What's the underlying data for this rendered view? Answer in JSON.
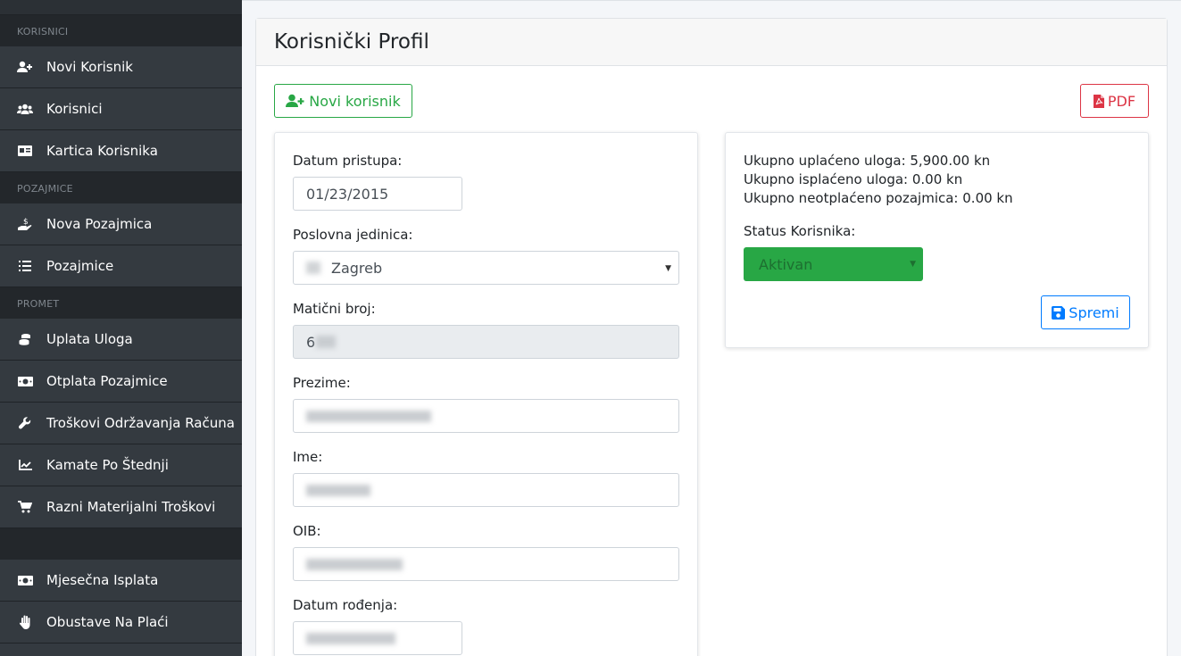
{
  "sidebar": {
    "sections": [
      {
        "title": "KORISNICI",
        "items": [
          {
            "label": "Novi Korisnik",
            "icon": "user-plus-icon"
          },
          {
            "label": "Korisnici",
            "icon": "users-icon"
          },
          {
            "label": "Kartica Korisnika",
            "icon": "id-card-icon"
          }
        ]
      },
      {
        "title": "POZAJMICE",
        "items": [
          {
            "label": "Nova Pozajmica",
            "icon": "hand-holding-dollar-icon"
          },
          {
            "label": "Pozajmice",
            "icon": "list-icon"
          }
        ]
      },
      {
        "title": "PROMET",
        "items": [
          {
            "label": "Uplata Uloga",
            "icon": "coins-icon"
          },
          {
            "label": "Otplata Pozajmice",
            "icon": "money-bill-icon"
          },
          {
            "label": "Troškovi Održavanja Računa",
            "icon": "wrench-icon"
          },
          {
            "label": "Kamate Po Štednji",
            "icon": "chart-line-icon"
          },
          {
            "label": "Razni Materijalni Troškovi",
            "icon": "shopping-cart-icon"
          }
        ]
      },
      {
        "title": "",
        "items": [
          {
            "label": "Mjesečna Isplata",
            "icon": "money-bill-icon"
          },
          {
            "label": "Obustave Na Plaći",
            "icon": "hand-paper-icon"
          }
        ]
      }
    ]
  },
  "page": {
    "title": "Korisnički Profil",
    "new_user_button": "Novi korisnik",
    "pdf_button": "PDF",
    "save_button": "Spremi"
  },
  "form": {
    "access_date_label": "Datum pristupa:",
    "access_date_value": "01/23/2015",
    "business_unit_label": "Poslovna jedinica:",
    "business_unit_value": "Zagreb",
    "reg_number_label": "Matični broj:",
    "reg_number_value": "6",
    "surname_label": "Prezime:",
    "name_label": "Ime:",
    "oib_label": "OIB:",
    "birth_date_label": "Datum rođenja:"
  },
  "summary": {
    "paid_deposits": "Ukupno uplaćeno uloga: 5,900.00 kn",
    "paid_out_deposits": "Ukupno isplaćeno uloga: 0.00 kn",
    "unpaid_loans": "Ukupno neotplaćeno pozajmica: 0.00 kn",
    "status_label": "Status Korisnika:",
    "status_value": "Aktivan"
  },
  "colors": {
    "sidebar_bg": "#343a40",
    "success": "#28a745",
    "danger": "#dc3545",
    "primary": "#007bff"
  }
}
